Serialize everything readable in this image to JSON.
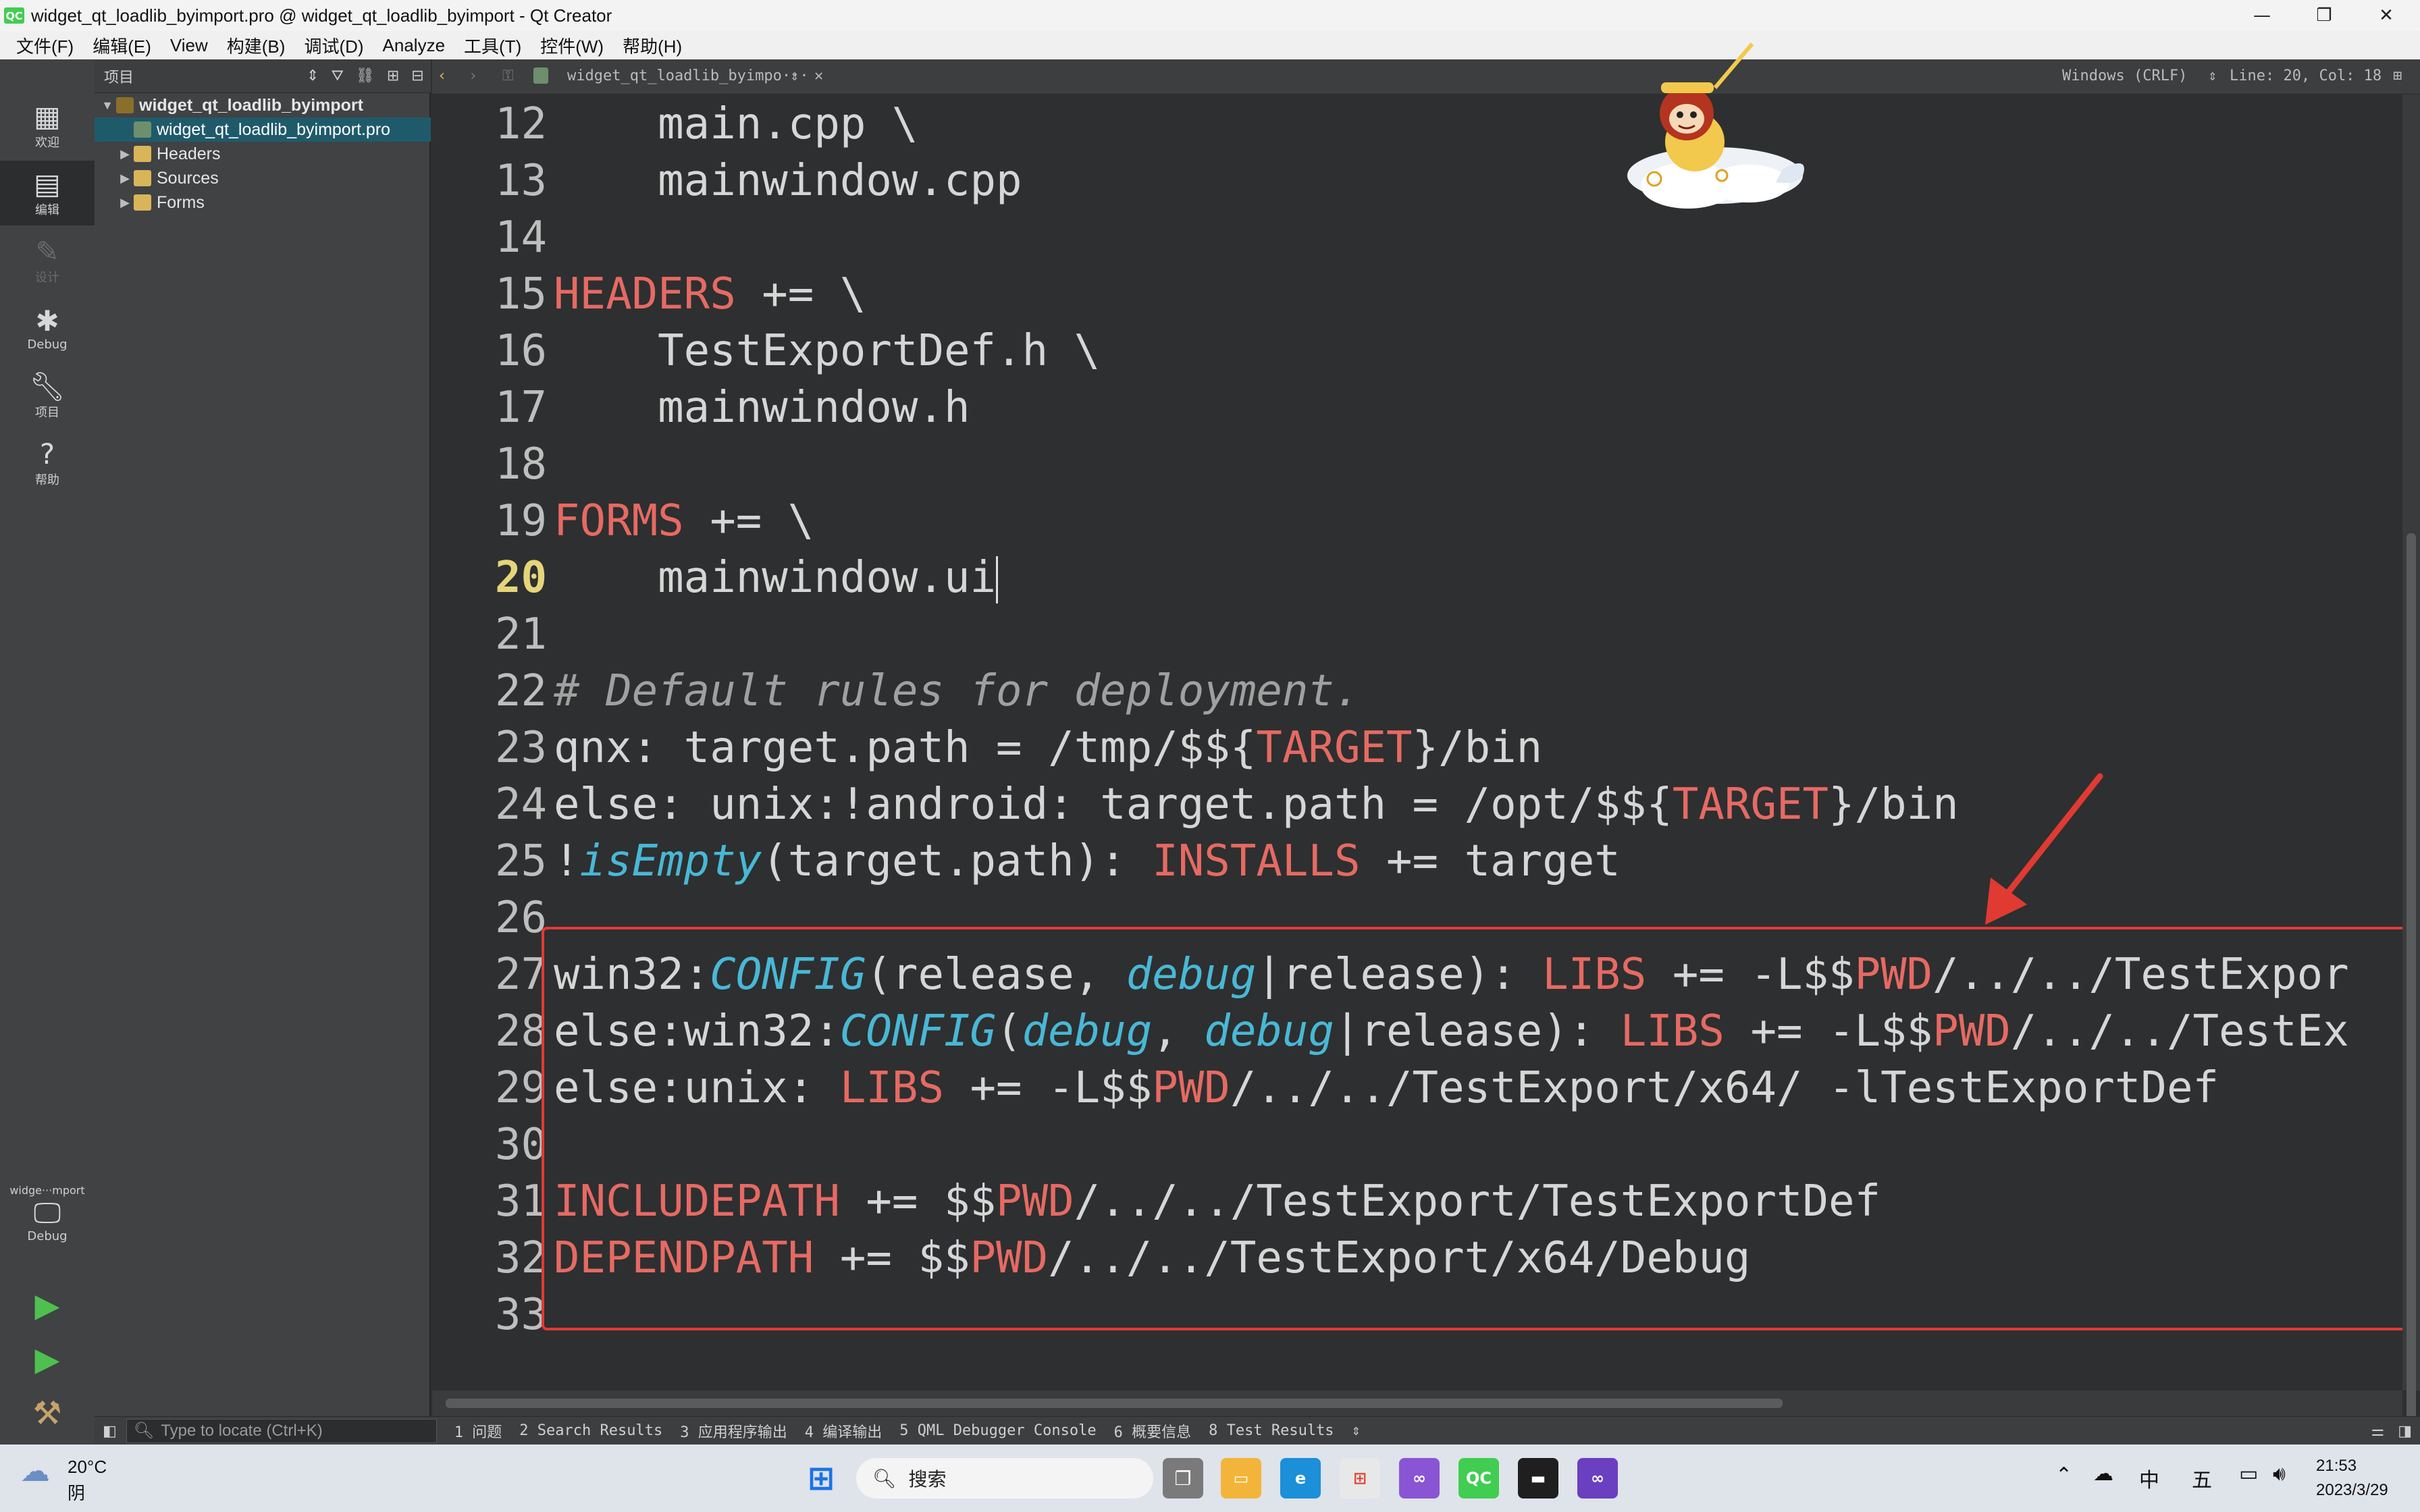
{
  "window": {
    "title": "widget_qt_loadlib_byimport.pro @ widget_qt_loadlib_byimport - Qt Creator",
    "logo": "QC",
    "minimize": "—",
    "maximize": "❐",
    "close": "✕"
  },
  "menu": [
    "文件(F)",
    "编辑(E)",
    "View",
    "构建(B)",
    "调试(D)",
    "Analyze",
    "工具(T)",
    "控件(W)",
    "帮助(H)"
  ],
  "modes": {
    "welcome": "欢迎",
    "edit": "编辑",
    "design": "设计",
    "debug": "Debug",
    "projects": "项目",
    "help": "帮助",
    "kit_name": "widge···mport",
    "kit_mode": "Debug"
  },
  "project_panel": {
    "view_label": "项目",
    "tree": [
      {
        "label": "widget_qt_loadlib_byimport",
        "level": 0,
        "bold": true,
        "icon": "project-icon"
      },
      {
        "label": "widget_qt_loadlib_byimport.pro",
        "level": 1,
        "selected": true,
        "icon": "pro-file-icon"
      },
      {
        "label": "Headers",
        "level": 1,
        "icon": "folder-icon"
      },
      {
        "label": "Sources",
        "level": 1,
        "icon": "folder-icon"
      },
      {
        "label": "Forms",
        "level": 1,
        "icon": "folder-icon"
      }
    ]
  },
  "editor_toolbar": {
    "file_name": "widget_qt_loadlib_byimpo···",
    "line_ending": "Windows (CRLF)",
    "position": "Line: 20, Col: 18"
  },
  "editor": {
    "current_line": 20,
    "lines": [
      {
        "n": "12",
        "text": "    main.cpp \\"
      },
      {
        "n": "13",
        "text": "    mainwindow.cpp"
      },
      {
        "n": "14",
        "text": ""
      },
      {
        "n": "15",
        "text": "HEADERS += \\"
      },
      {
        "n": "16",
        "text": "    TestExportDef.h \\"
      },
      {
        "n": "17",
        "text": "    mainwindow.h"
      },
      {
        "n": "18",
        "text": ""
      },
      {
        "n": "19",
        "text": "FORMS += \\"
      },
      {
        "n": "20",
        "text": "    mainwindow.ui"
      },
      {
        "n": "21",
        "text": ""
      },
      {
        "n": "22",
        "text": "# Default rules for deployment."
      },
      {
        "n": "23",
        "text": "qnx: target.path = /tmp/$${TARGET}/bin"
      },
      {
        "n": "24",
        "text": "else: unix:!android: target.path = /opt/$${TARGET}/bin"
      },
      {
        "n": "25",
        "text": "!isEmpty(target.path): INSTALLS += target"
      },
      {
        "n": "26",
        "text": ""
      },
      {
        "n": "27",
        "text": "win32:CONFIG(release, debug|release): LIBS += -L$$PWD/../../TestExpor"
      },
      {
        "n": "28",
        "text": "else:win32:CONFIG(debug, debug|release): LIBS += -L$$PWD/../../TestEx"
      },
      {
        "n": "29",
        "text": "else:unix: LIBS += -L$$PWD/../../TestExport/x64/ -lTestExportDef"
      },
      {
        "n": "30",
        "text": ""
      },
      {
        "n": "31",
        "text": "INCLUDEPATH += $$PWD/../../TestExport/TestExportDef"
      },
      {
        "n": "32",
        "text": "DEPENDPATH += $$PWD/../../TestExport/x64/Debug"
      },
      {
        "n": "33",
        "text": ""
      }
    ]
  },
  "output_bar": {
    "locate_placeholder": "Type to locate (Ctrl+K)",
    "tabs": [
      "1 问题",
      "2 Search Results",
      "3 应用程序输出",
      "4 编译输出",
      "5 QML Debugger Console",
      "6 概要信息",
      "8 Test Results"
    ]
  },
  "taskbar": {
    "weather_temp": "20°C",
    "weather_desc": "阴",
    "search_label": "搜索",
    "ime_lang": "中",
    "ime_day": "五",
    "time": "21:53",
    "date": "2023/3/29"
  },
  "colors": {
    "keyword": "#e66a63",
    "function": "#48b8d6",
    "comment": "#a0a0a0",
    "highlight_box": "#e03a33",
    "selection": "#1f5a6b"
  }
}
